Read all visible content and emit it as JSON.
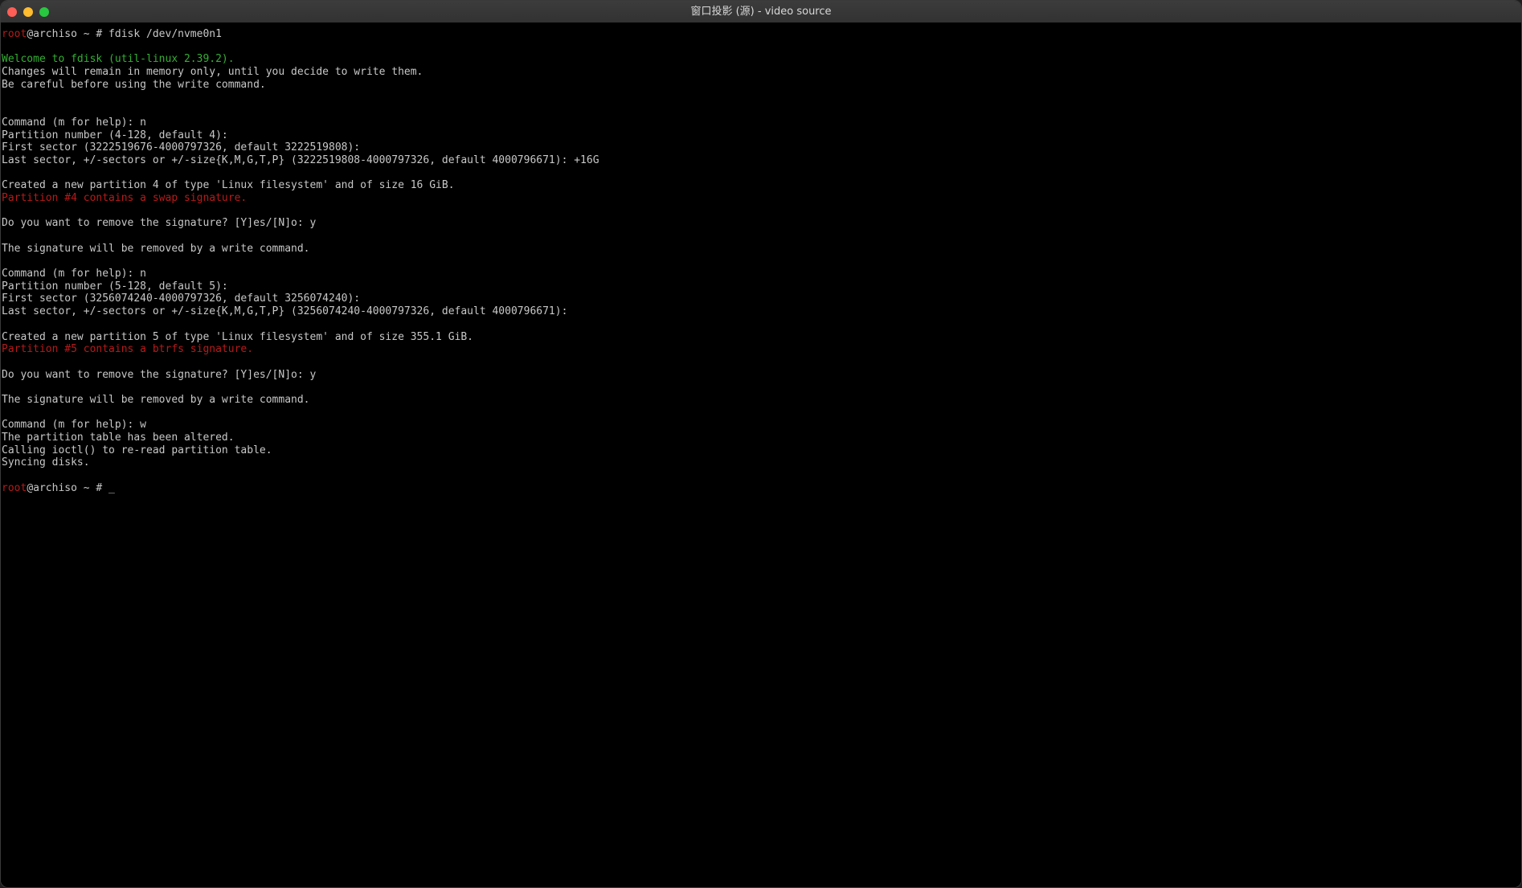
{
  "window": {
    "title": "窗口投影 (源) - video source"
  },
  "terminal": {
    "lines": [
      {
        "text": "root@archiso ~ # fdisk /dev/nvme0n1",
        "prompt": true
      },
      {
        "text": ""
      },
      {
        "text": "Welcome to fdisk (util-linux 2.39.2).",
        "color": "green"
      },
      {
        "text": "Changes will remain in memory only, until you decide to write them."
      },
      {
        "text": "Be careful before using the write command."
      },
      {
        "text": ""
      },
      {
        "text": ""
      },
      {
        "text": "Command (m for help): n"
      },
      {
        "text": "Partition number (4-128, default 4):"
      },
      {
        "text": "First sector (3222519676-4000797326, default 3222519808):"
      },
      {
        "text": "Last sector, +/-sectors or +/-size{K,M,G,T,P} (3222519808-4000797326, default 4000796671): +16G"
      },
      {
        "text": ""
      },
      {
        "text": "Created a new partition 4 of type 'Linux filesystem' and of size 16 GiB."
      },
      {
        "text": "Partition #4 contains a swap signature.",
        "color": "red"
      },
      {
        "text": ""
      },
      {
        "text": "Do you want to remove the signature? [Y]es/[N]o: y"
      },
      {
        "text": ""
      },
      {
        "text": "The signature will be removed by a write command."
      },
      {
        "text": ""
      },
      {
        "text": "Command (m for help): n"
      },
      {
        "text": "Partition number (5-128, default 5):"
      },
      {
        "text": "First sector (3256074240-4000797326, default 3256074240):"
      },
      {
        "text": "Last sector, +/-sectors or +/-size{K,M,G,T,P} (3256074240-4000797326, default 4000796671):"
      },
      {
        "text": ""
      },
      {
        "text": "Created a new partition 5 of type 'Linux filesystem' and of size 355.1 GiB."
      },
      {
        "text": "Partition #5 contains a btrfs signature.",
        "color": "red"
      },
      {
        "text": ""
      },
      {
        "text": "Do you want to remove the signature? [Y]es/[N]o: y"
      },
      {
        "text": ""
      },
      {
        "text": "The signature will be removed by a write command."
      },
      {
        "text": ""
      },
      {
        "text": "Command (m for help): w"
      },
      {
        "text": "The partition table has been altered."
      },
      {
        "text": "Calling ioctl() to re-read partition table."
      },
      {
        "text": "Syncing disks."
      },
      {
        "text": ""
      },
      {
        "text": "root@archiso ~ # _",
        "prompt": true
      }
    ],
    "prompt_user": "root",
    "prompt_rest_1": "@archiso ~ # fdisk /dev/nvme0n1",
    "prompt_rest_2": "@archiso ~ # ",
    "cursor": "_"
  },
  "colors": {
    "text": "#c8c8c8",
    "red": "#b81a1a",
    "green": "#34b034",
    "background": "#000000"
  }
}
